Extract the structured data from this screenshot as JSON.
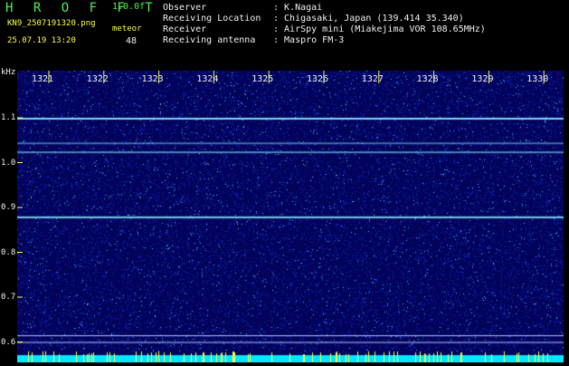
{
  "app": {
    "title": "H R O F F T",
    "version": "1.0.0f",
    "file_name": "KN9_2507191320.png",
    "date_time": "25.07.19 13:20",
    "meteor_label": "meteor",
    "meteor_count": "48"
  },
  "info": [
    {
      "key": "Observer",
      "value": ": K.Nagai"
    },
    {
      "key": "Receiving Location",
      "value": ": Chigasaki, Japan (139.414 35.340)"
    },
    {
      "key": "Receiver",
      "value": ": AirSpy mini (Miakejima VOR 108.65MHz)"
    },
    {
      "key": "Receiving antenna",
      "value": ": Maspro FM-3"
    }
  ],
  "axis": {
    "unit": "kHz",
    "freq_ticks": [
      "1.1",
      "1.0",
      "0.9",
      "0.8",
      "0.7",
      "0.6"
    ],
    "freq_values": [
      1.1,
      1.0,
      0.9,
      0.8,
      0.7,
      0.6
    ],
    "time_ticks": [
      "1321",
      "1322",
      "1323",
      "1324",
      "1325",
      "1326",
      "1327",
      "1328",
      "1329",
      "1330"
    ]
  },
  "colors": {
    "background": "#03035c",
    "noise_low": "#1030c8",
    "noise_high": "#40c8ff",
    "carrier": "#8ff0ff",
    "guide_line": "#b8c8ff",
    "timeline": "#00e8ff",
    "burst": "#ffff40",
    "label_green": "#4df04d",
    "label_yellow": "#ffff40"
  }
}
